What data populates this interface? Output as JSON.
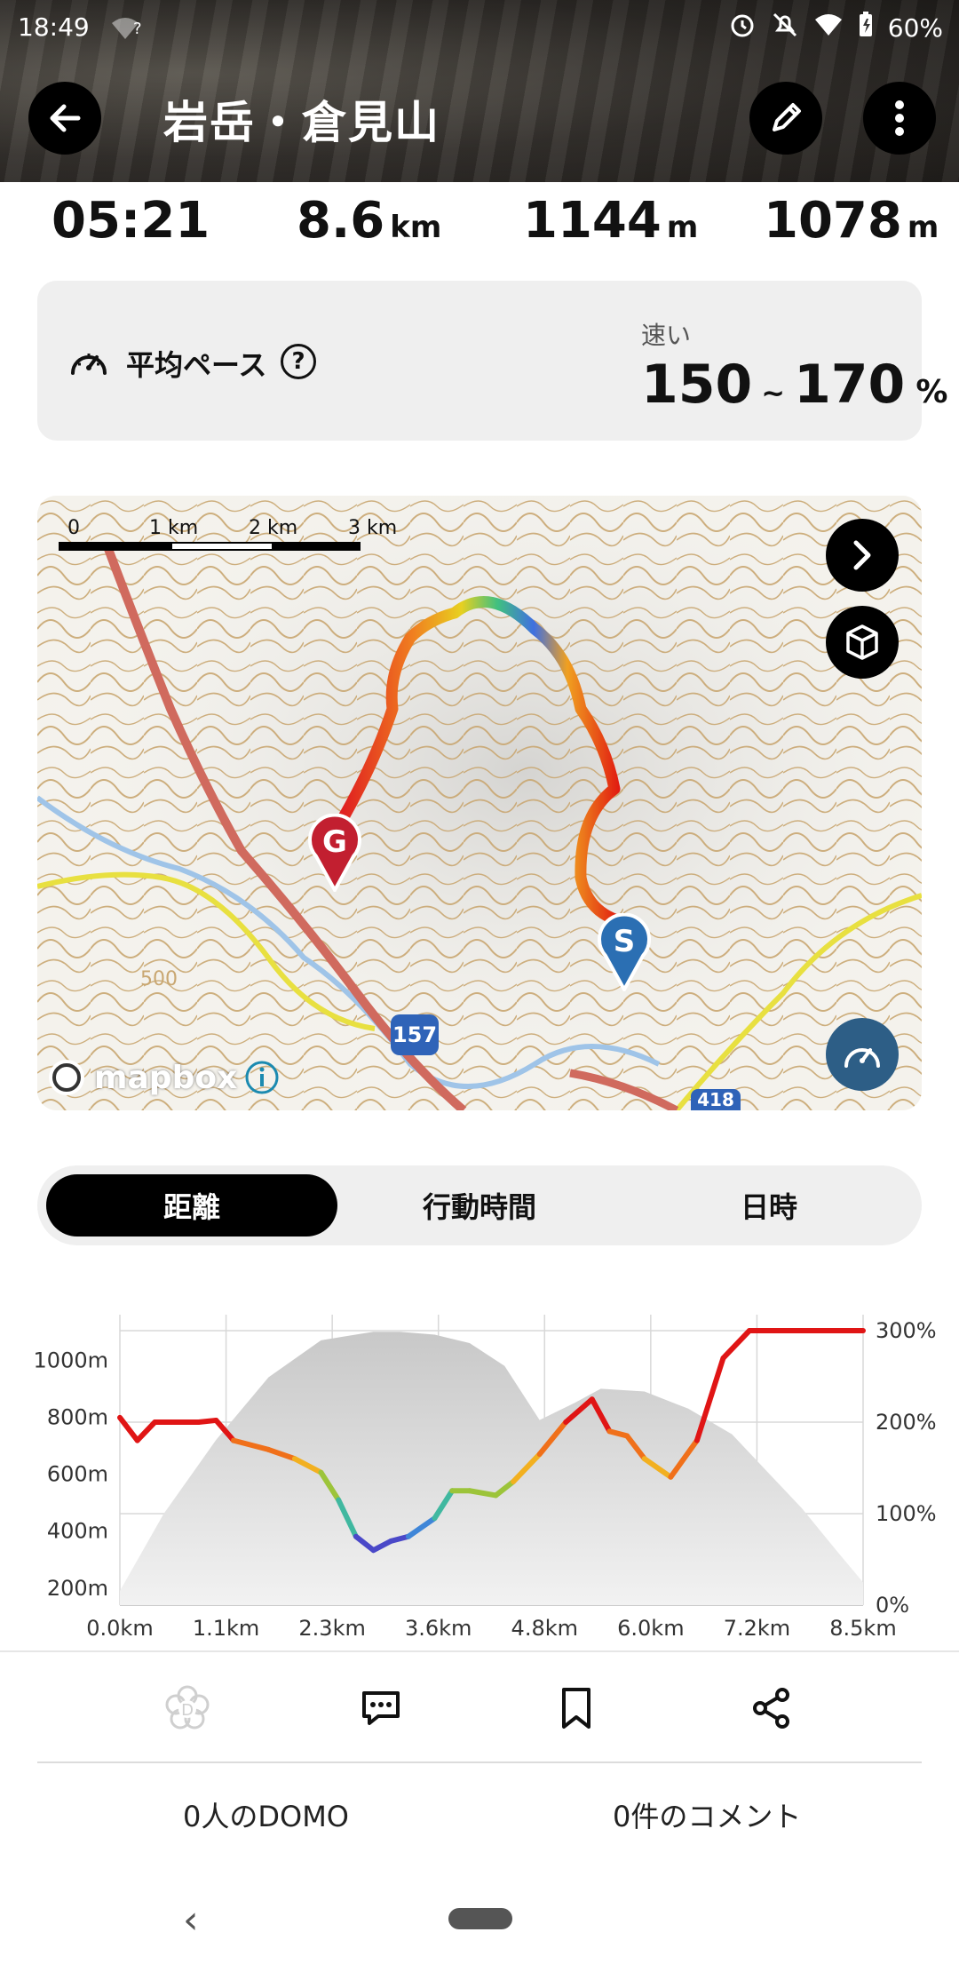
{
  "status_bar": {
    "time": "18:49",
    "battery": "60%",
    "wifi_question": "?"
  },
  "header": {
    "title": "岩岳・倉見山"
  },
  "stats": [
    {
      "value": "05:21",
      "unit": ""
    },
    {
      "value": "8.6",
      "unit": "km"
    },
    {
      "value": "1144",
      "unit": "m"
    },
    {
      "value": "1078",
      "unit": "m"
    }
  ],
  "pace": {
    "label": "平均ペース",
    "help": "?",
    "speed_word": "速い",
    "min": "150",
    "tilde": "~",
    "max": "170",
    "unit": "%"
  },
  "map": {
    "scale_labels": [
      "0",
      "1 km",
      "2 km",
      "3 km"
    ],
    "start_marker": "S",
    "goal_marker": "G",
    "road_labels": [
      "157",
      "418"
    ],
    "contour_label": "500",
    "attribution": "mapbox"
  },
  "tabs": [
    {
      "label": "距離",
      "active": true
    },
    {
      "label": "行動時間",
      "active": false
    },
    {
      "label": "日時",
      "active": false
    }
  ],
  "chart_data": {
    "type": "area",
    "left_axis": {
      "ticks": [
        "1000m",
        "800m",
        "600m",
        "400m",
        "200m"
      ]
    },
    "right_axis": {
      "ticks": [
        "300%",
        "200%",
        "100%",
        "0%"
      ]
    },
    "x_ticks": [
      "0.0km",
      "1.1km",
      "2.3km",
      "3.6km",
      "4.8km",
      "6.0km",
      "7.2km",
      "8.5km"
    ],
    "series": [
      {
        "kind": "elevation_area",
        "x_km": [
          0,
          0.5,
          1.1,
          1.7,
          2.3,
          2.9,
          3.2,
          3.6,
          4.0,
          4.4,
          4.8,
          5.2,
          5.5,
          6.0,
          6.5,
          7.0,
          7.4,
          7.8,
          8.2,
          8.5
        ],
        "elevation_m": [
          190,
          460,
          720,
          940,
          1070,
          1100,
          1100,
          1090,
          1060,
          980,
          790,
          850,
          900,
          890,
          830,
          740,
          610,
          480,
          330,
          220
        ]
      },
      {
        "kind": "pace_line",
        "x_km": [
          0,
          0.2,
          0.4,
          0.6,
          0.9,
          1.1,
          1.3,
          1.7,
          2.0,
          2.3,
          2.5,
          2.7,
          2.9,
          3.1,
          3.3,
          3.6,
          3.8,
          4.0,
          4.3,
          4.5,
          4.8,
          5.1,
          5.4,
          5.6,
          5.8,
          6.0,
          6.3,
          6.6,
          6.9,
          7.2,
          7.5,
          7.8,
          8.2,
          8.5
        ],
        "pace_pct": [
          205,
          180,
          200,
          200,
          200,
          202,
          180,
          170,
          160,
          145,
          115,
          75,
          60,
          70,
          75,
          95,
          125,
          125,
          120,
          135,
          165,
          200,
          225,
          190,
          185,
          160,
          140,
          180,
          270,
          300,
          300,
          300,
          300,
          300
        ]
      }
    ]
  },
  "actions": {
    "domo_count": "0人のDOMO",
    "comment_count": "0件のコメント"
  },
  "nav": {
    "back": "‹"
  }
}
